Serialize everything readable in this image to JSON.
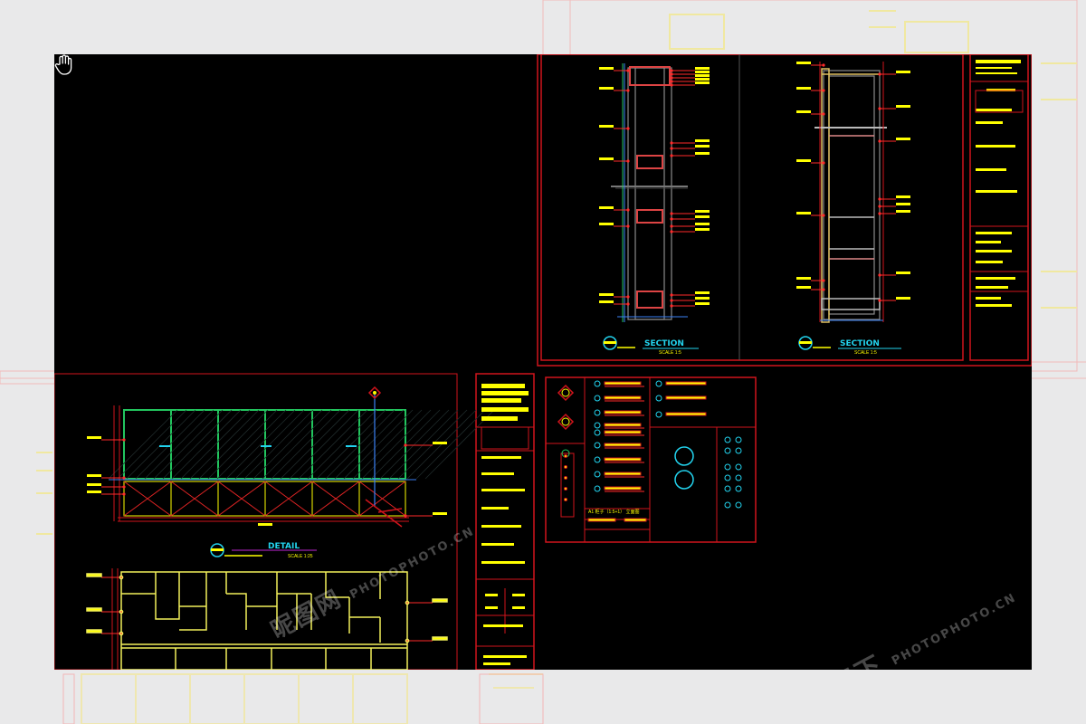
{
  "colors": {
    "canvas": "#000000",
    "frame": "#d0141c",
    "title_text": "#22d3ee",
    "leader": "#ff2a2a",
    "label_block": "#ffff00",
    "elevation_green": "#22c55e",
    "elevation_yellow": "#f2ef5a",
    "grid_magenta": "#c026d3"
  },
  "cursor": {
    "icon": "hand-pan-icon"
  },
  "drawings": {
    "section_1": {
      "title": "SECTION",
      "scale": "SCALE 1:5"
    },
    "section_2": {
      "title": "SECTION",
      "scale": "SCALE 1:5"
    },
    "detail": {
      "title": "DETAIL",
      "scale": "SCALE 1:25"
    },
    "legend_note": "A1 柜子（1:5+1）  立面图"
  },
  "watermark": {
    "logo_text": "昵图网",
    "site_text": "PHOTOPHOTO.CN",
    "brand_script": "图行天下"
  }
}
